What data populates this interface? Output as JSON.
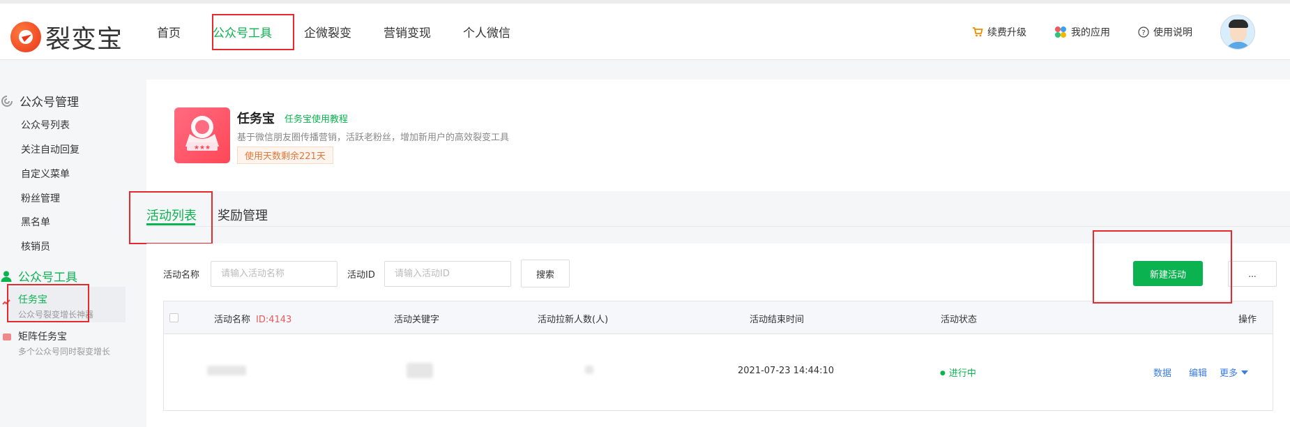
{
  "header": {
    "logo_text": "裂变宝",
    "nav": [
      "首页",
      "公众号工具",
      "企微裂变",
      "营销变现",
      "个人微信"
    ],
    "right_links": [
      {
        "label": "续费升级",
        "icon": "cart-icon"
      },
      {
        "label": "我的应用",
        "icon": "apps-icon"
      },
      {
        "label": "使用说明",
        "icon": "help-icon"
      }
    ]
  },
  "sidebar": {
    "group1": "公众号管理",
    "group1_items": [
      "公众号列表",
      "关注自动回复",
      "自定义菜单",
      "粉丝管理",
      "黑名单",
      "核销员"
    ],
    "group2": "公众号工具",
    "tools": [
      {
        "title": "任务宝",
        "subtitle": "公众号裂变增长神器"
      },
      {
        "title": "矩阵任务宝",
        "subtitle": "多个公众号同时裂变增长"
      }
    ]
  },
  "app": {
    "title": "任务宝",
    "tutorial_link": "任务宝使用教程",
    "description": "基于微信朋友圈传播营销，活跃老粉丝，增加新用户的高效裂变工具",
    "days_left": "使用天数剩余221天"
  },
  "tabs": [
    "活动列表",
    "奖励管理"
  ],
  "filters": {
    "name_label": "活动名称",
    "name_placeholder": "请输入活动名称",
    "id_label": "活动ID",
    "id_placeholder": "请输入活动ID",
    "search_button": "搜索",
    "new_button": "新建活动",
    "more_button": "..."
  },
  "table": {
    "headers": {
      "name": "活动名称",
      "id_tag": "ID:4143",
      "keyword": "活动关键字",
      "new_users": "活动拉新人数(人)",
      "end_time": "活动结束时间",
      "status": "活动状态",
      "actions": "操作"
    },
    "rows": [
      {
        "end_time": "2021-07-23 14:44:10",
        "status": "进行中",
        "actions": [
          "数据",
          "编辑",
          "更多"
        ]
      }
    ]
  },
  "colors": {
    "accent": "#0ab34f",
    "highlight_box": "#e8282a",
    "link": "#3a7be8"
  }
}
